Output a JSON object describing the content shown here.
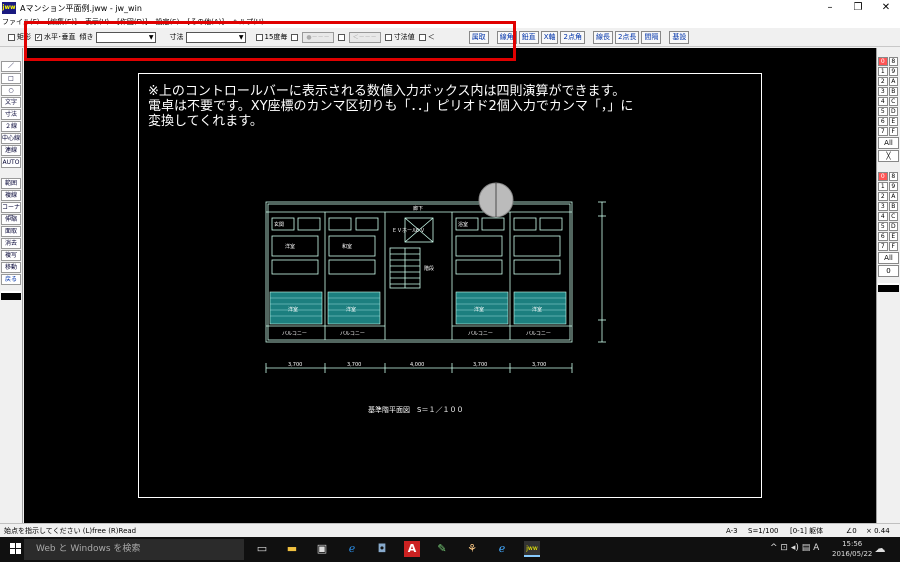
{
  "window": {
    "icon": "jww",
    "title": "Aマンション平面例.jww - jw_win",
    "minimize": "–",
    "maximize": "❐",
    "close": "✕"
  },
  "menu": [
    "ファイル(F)",
    "[編集(E)]",
    "表示(V)",
    "[作図(D)]",
    "設定(S)",
    "[その他(A)]",
    "ヘルプ(H)"
  ],
  "toolbar": {
    "rect_label": "矩形",
    "horiz_vert_label": "水平･垂直",
    "slope_label": "傾き",
    "dim_label": "寸法",
    "deg15_label": "15度毎",
    "dots1": "●－－－",
    "dots2": "＜－－－",
    "dimval_label": "寸法値",
    "arrow_label": "＜",
    "buttons": [
      "属取",
      "線角",
      "鉛直",
      "X軸",
      "2点角",
      "線長",
      "2点長",
      "間隔",
      "基設"
    ]
  },
  "left_tools": [
    "／",
    "□",
    "○",
    "文字",
    "寸法",
    "２線",
    "中心線",
    "連線",
    "AUTO",
    "範囲",
    "複線",
    "コーナー",
    "伸縮",
    "面取",
    "消去",
    "複写",
    "移動",
    "戻る"
  ],
  "right_layers": {
    "groups_top": [
      [
        "0",
        "8"
      ],
      [
        "1",
        "9"
      ],
      [
        "2",
        "A"
      ],
      [
        "3",
        "B"
      ],
      [
        "4",
        "C"
      ],
      [
        "5",
        "D"
      ],
      [
        "6",
        "E"
      ],
      [
        "7",
        "F"
      ]
    ],
    "all_top": "All",
    "x_top": "╳",
    "groups_bottom": [
      [
        "0",
        "8"
      ],
      [
        "1",
        "9"
      ],
      [
        "2",
        "A"
      ],
      [
        "3",
        "B"
      ],
      [
        "4",
        "C"
      ],
      [
        "5",
        "D"
      ],
      [
        "6",
        "E"
      ],
      [
        "7",
        "F"
      ]
    ],
    "all_bottom": "All",
    "zero_bottom": "0"
  },
  "drawing": {
    "note_lines": [
      "※上のコントロールバーに表示される数値入力ボックス内は四則演算ができます。",
      "電卓は不要です。XY座標のカンマ区切りも「．．」ピリオド2個入力でカンマ「，」に",
      "変換してくれます。"
    ],
    "caption": "基準階平面図　S＝１／１００",
    "rooms": [
      "玄関",
      "洋室",
      "和室",
      "浴室",
      "洋室",
      "洋室",
      "洋室",
      "洋室"
    ],
    "balcony": [
      "バルコニー",
      "バルコニー",
      "バルコニー",
      "バルコニー"
    ],
    "ev_label": "ＥＶ",
    "ev_hall_label": "ＥＶホール",
    "stairs_label": "階段",
    "corridor_label": "廊下",
    "dims": [
      "3,700",
      "3,700",
      "4,000",
      "3,700",
      "3,700"
    ]
  },
  "status": {
    "message": "始点を指示してください (L)free (R)Read",
    "paper": "A-3",
    "scale": "S=1/100",
    "layer": "[0-1] 躯体",
    "angle": "∠0",
    "zoom": "× 0.44"
  },
  "taskbar": {
    "search": "Web と Windows を検索",
    "time": "15:56",
    "date": "2016/05/22",
    "ime": "A"
  }
}
